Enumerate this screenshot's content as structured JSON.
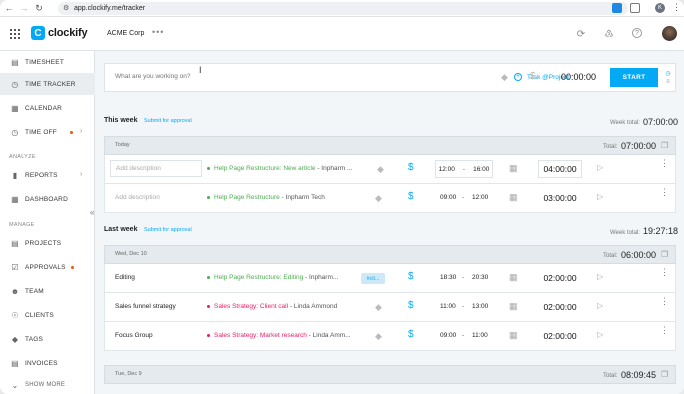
{
  "browser": {
    "url": "app.clockify.me/tracker",
    "profile_initial": "K"
  },
  "header": {
    "app_name": "clockify",
    "workspace": "ACME Corp"
  },
  "sidebar": {
    "items": [
      {
        "label": "TIMESHEET",
        "icon": "timesheet-icon"
      },
      {
        "label": "TIME TRACKER",
        "icon": "clock-icon",
        "active": true
      },
      {
        "label": "CALENDAR",
        "icon": "calendar-icon"
      },
      {
        "label": "TIME OFF",
        "icon": "time-off-icon"
      }
    ],
    "analyze_label": "ANALYZE",
    "analyze_items": [
      {
        "label": "REPORTS",
        "icon": "reports-icon"
      },
      {
        "label": "DASHBOARD",
        "icon": "dashboard-icon"
      }
    ],
    "manage_label": "MANAGE",
    "manage_items": [
      {
        "label": "PROJECTS",
        "icon": "projects-icon"
      },
      {
        "label": "APPROVALS",
        "icon": "approvals-icon"
      },
      {
        "label": "TEAM",
        "icon": "team-icon"
      },
      {
        "label": "CLIENTS",
        "icon": "clients-icon"
      },
      {
        "label": "TAGS",
        "icon": "tag-icon"
      },
      {
        "label": "INVOICES",
        "icon": "invoices-icon"
      }
    ],
    "show_more": "SHOW MORE"
  },
  "timer": {
    "placeholder": "What are you working on?",
    "task_project": "Task @Project",
    "time": "00:00:00",
    "start_label": "START"
  },
  "weeks": [
    {
      "title": "This week",
      "submit": "Submit for approval",
      "total_label": "Week total:",
      "total": "07:00:00",
      "days": [
        {
          "label": "Today",
          "total_label": "Total:",
          "total": "07:00:00",
          "entries": [
            {
              "description": "",
              "placeholder": "Add description",
              "project": "Help Page Restructure: New article",
              "client": "Inpharm ...",
              "project_color": "#4caf50",
              "start": "12:00",
              "end": "16:00",
              "duration": "04:00:00",
              "billable": true
            },
            {
              "description": "",
              "placeholder": "Add description",
              "project": "Help Page Restructure",
              "client": "Inpharm Tech",
              "project_color": "#4caf50",
              "start": "09:00",
              "end": "12:00",
              "duration": "03:00:00",
              "billable": true
            }
          ]
        }
      ]
    },
    {
      "title": "Last week",
      "submit": "Submit for approval",
      "total_label": "Week total:",
      "total": "19:27:18",
      "days": [
        {
          "label": "Wed, Dec 10",
          "total_label": "Total:",
          "total": "06:00:00",
          "entries": [
            {
              "description": "Editing",
              "project": "Help Page Restructure: Editing",
              "client": "Inpharm...",
              "project_color": "#4caf50",
              "tag": "#cli...",
              "start": "18:30",
              "end": "20:30",
              "duration": "02:00:00",
              "billable": true
            },
            {
              "description": "Sales funnel strategy",
              "project": "Sales Strategy: Client call",
              "client": "Linda Ammond",
              "project_color": "#e91e63",
              "start": "11:00",
              "end": "13:00",
              "duration": "02:00:00",
              "billable": true
            },
            {
              "description": "Focus Group",
              "project": "Sales Strategy: Market research",
              "client": "Linda Amm...",
              "project_color": "#e91e63",
              "start": "09:00",
              "end": "11:00",
              "duration": "02:00:00",
              "billable": true
            }
          ]
        },
        {
          "label": "Tue, Dec 9",
          "total_label": "Total:",
          "total": "08:09:45",
          "entries": []
        }
      ]
    }
  ],
  "colors": {
    "accent": "#03a9f4",
    "green_project": "#4caf50",
    "pink_project": "#e91e63"
  }
}
